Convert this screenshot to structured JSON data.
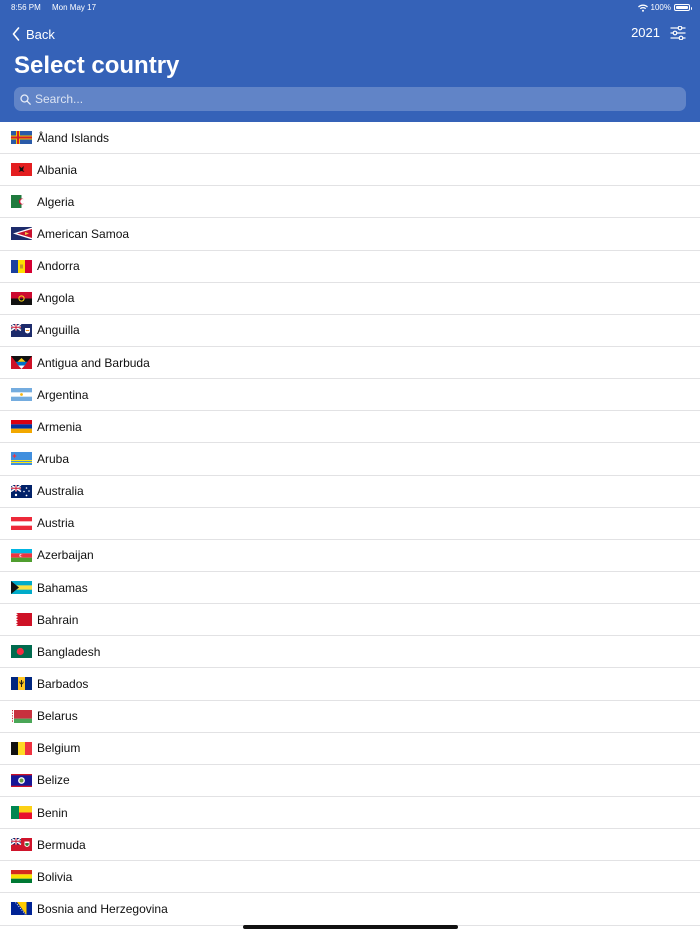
{
  "status_bar": {
    "time": "8:56 PM",
    "date": "Mon May 17",
    "battery": "100%",
    "icons": [
      "wifi-icon",
      "battery-icon"
    ]
  },
  "nav": {
    "back_label": "Back",
    "back_icon": "chevron-left-icon",
    "year": "2021",
    "filter_icon": "sliders-icon"
  },
  "page": {
    "title": "Select country"
  },
  "search": {
    "placeholder": "Search...",
    "icon": "magnifier-icon"
  },
  "countries": [
    {
      "name": "Åland Islands",
      "flag": "aland-islands-flag-icon"
    },
    {
      "name": "Albania",
      "flag": "albania-flag-icon"
    },
    {
      "name": "Algeria",
      "flag": "algeria-flag-icon"
    },
    {
      "name": "American Samoa",
      "flag": "american-samoa-flag-icon"
    },
    {
      "name": "Andorra",
      "flag": "andorra-flag-icon"
    },
    {
      "name": "Angola",
      "flag": "angola-flag-icon"
    },
    {
      "name": "Anguilla",
      "flag": "anguilla-flag-icon"
    },
    {
      "name": "Antigua and Barbuda",
      "flag": "antigua-and-barbuda-flag-icon"
    },
    {
      "name": "Argentina",
      "flag": "argentina-flag-icon"
    },
    {
      "name": "Armenia",
      "flag": "armenia-flag-icon"
    },
    {
      "name": "Aruba",
      "flag": "aruba-flag-icon"
    },
    {
      "name": "Australia",
      "flag": "australia-flag-icon"
    },
    {
      "name": "Austria",
      "flag": "austria-flag-icon"
    },
    {
      "name": "Azerbaijan",
      "flag": "azerbaijan-flag-icon"
    },
    {
      "name": "Bahamas",
      "flag": "bahamas-flag-icon"
    },
    {
      "name": "Bahrain",
      "flag": "bahrain-flag-icon"
    },
    {
      "name": "Bangladesh",
      "flag": "bangladesh-flag-icon"
    },
    {
      "name": "Barbados",
      "flag": "barbados-flag-icon"
    },
    {
      "name": "Belarus",
      "flag": "belarus-flag-icon"
    },
    {
      "name": "Belgium",
      "flag": "belgium-flag-icon"
    },
    {
      "name": "Belize",
      "flag": "belize-flag-icon"
    },
    {
      "name": "Benin",
      "flag": "benin-flag-icon"
    },
    {
      "name": "Bermuda",
      "flag": "bermuda-flag-icon"
    },
    {
      "name": "Bolivia",
      "flag": "bolivia-flag-icon"
    },
    {
      "name": "Bosnia and Herzegovina",
      "flag": "bosnia-and-herzegovina-flag-icon"
    }
  ],
  "colors": {
    "header": "#3562b8",
    "divider": "#e2e2e4",
    "text": "#111111"
  }
}
